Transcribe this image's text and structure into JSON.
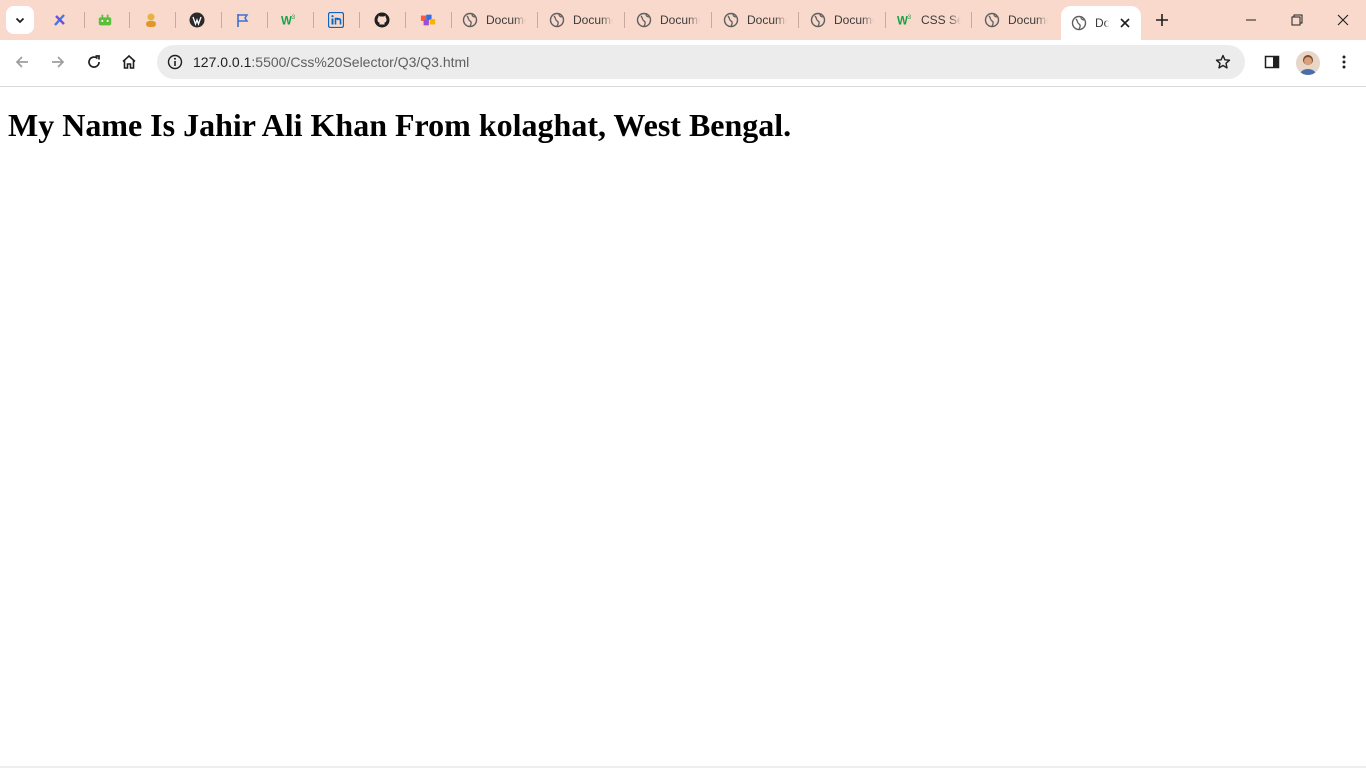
{
  "browser": {
    "tabs": [
      {
        "title": "",
        "icon": "pen-tool-icon"
      },
      {
        "title": "",
        "icon": "android-robot-icon"
      },
      {
        "title": "",
        "icon": "character-icon"
      },
      {
        "title": "",
        "icon": "wordpress-icon"
      },
      {
        "title": "",
        "icon": "flag-icon"
      },
      {
        "title": "",
        "icon": "w3schools-icon"
      },
      {
        "title": "",
        "icon": "linkedin-icon"
      },
      {
        "title": "",
        "icon": "github-icon"
      },
      {
        "title": "",
        "icon": "colorful-blocks-icon"
      },
      {
        "title": "Document",
        "icon": "globe-icon"
      },
      {
        "title": "Document",
        "icon": "globe-icon"
      },
      {
        "title": "Document",
        "icon": "globe-icon"
      },
      {
        "title": "Document",
        "icon": "globe-icon"
      },
      {
        "title": "Document",
        "icon": "globe-icon"
      },
      {
        "title": "CSS Selectors",
        "icon": "w3schools-icon"
      },
      {
        "title": "Document",
        "icon": "globe-icon"
      },
      {
        "title": "Document",
        "icon": "globe-icon",
        "active": true
      }
    ],
    "address_bar": {
      "host": "127.0.0.1",
      "path": ":5500/Css%20Selector/Q3/Q3.html"
    },
    "colors": {
      "tabstrip": "#f9d9cb",
      "active_tab": "#ffffff",
      "omnibox": "#ececec"
    }
  },
  "page": {
    "heading": "My Name Is Jahir Ali Khan From kolaghat, West Bengal."
  }
}
